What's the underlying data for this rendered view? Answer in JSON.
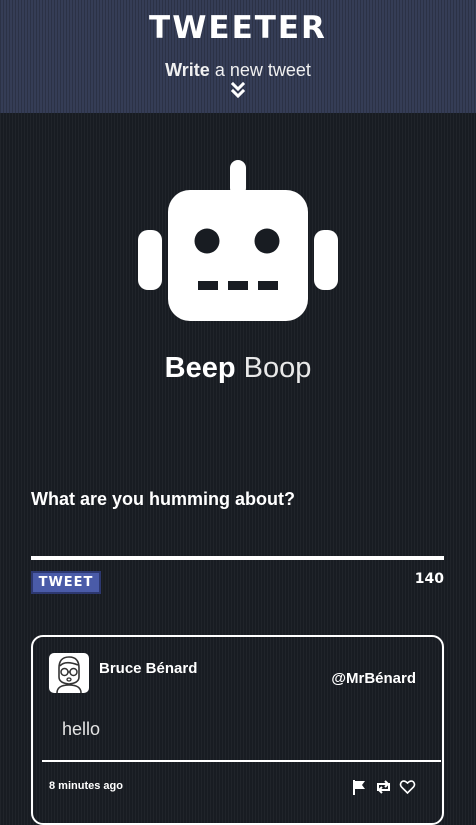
{
  "header": {
    "brand": "TWEETER",
    "compose_toggle": {
      "strong": "Write",
      "rest": " a new tweet"
    }
  },
  "profile": {
    "avatar_icon": "robot-icon",
    "first_name": "Beep",
    "last_name": "Boop"
  },
  "composer": {
    "label": "What are you humming about?",
    "input_value": "",
    "button_label": "TWEET",
    "char_count": "140"
  },
  "feed": {
    "tweets": [
      {
        "author_name": "Bruce Bénard",
        "handle": "@MrBénard",
        "avatar_icon": "user-avatar-icon",
        "text": "hello",
        "timestamp": "8 minutes ago",
        "actions": [
          "flag-icon",
          "retweet-icon",
          "heart-icon"
        ]
      }
    ]
  },
  "colors": {
    "header_bg": "#353d56",
    "page_bg": "#181c22",
    "button_bg": "#4a5ba8",
    "text": "#ffffff"
  }
}
